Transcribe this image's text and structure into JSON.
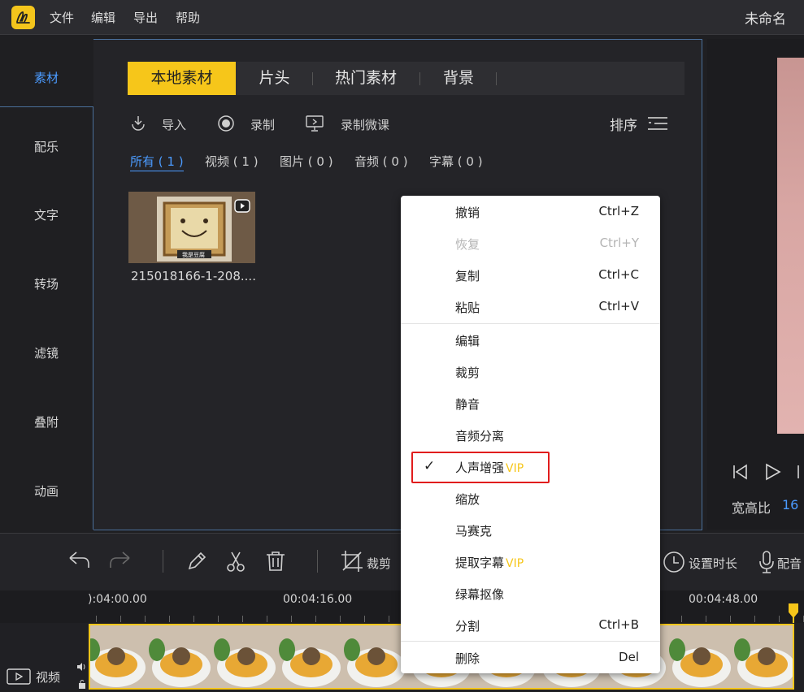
{
  "app": {
    "menu": [
      "文件",
      "编辑",
      "导出",
      "帮助"
    ],
    "project_name": "未命名"
  },
  "sidebar": {
    "items": [
      {
        "label": "素材",
        "active": true
      },
      {
        "label": "配乐"
      },
      {
        "label": "文字"
      },
      {
        "label": "转场"
      },
      {
        "label": "滤镜"
      },
      {
        "label": "叠附"
      },
      {
        "label": "动画"
      }
    ]
  },
  "media": {
    "tabs": [
      "本地素材",
      "片头",
      "热门素材",
      "背景"
    ],
    "tools": {
      "import": "导入",
      "record": "录制",
      "record_lesson": "录制微课",
      "sort": "排序"
    },
    "filters": [
      "所有 ( 1 )",
      "视频 ( 1 )",
      "图片 ( 0 )",
      "音频 ( 0 )",
      "字幕 ( 0 )"
    ],
    "thumb_overlay": "我是豆腐",
    "item_name": "215018166-1-208...."
  },
  "preview": {
    "ratio_label": "宽高比",
    "ratio_value": "16"
  },
  "timeline": {
    "crop_label": "裁剪",
    "set_duration_label": "设置时长",
    "dub_label": "配音",
    "times": [
      "):04:00.00",
      "00:04:16.00",
      "00:04:48.00"
    ],
    "track_label": "视频"
  },
  "context_menu": {
    "items": [
      {
        "label": "撤销",
        "shortcut": "Ctrl+Z"
      },
      {
        "label": "恢复",
        "shortcut": "Ctrl+Y",
        "disabled": true
      },
      {
        "label": "复制",
        "shortcut": "Ctrl+C"
      },
      {
        "label": "粘贴",
        "shortcut": "Ctrl+V"
      },
      {
        "label": "编辑"
      },
      {
        "label": "裁剪"
      },
      {
        "label": "静音"
      },
      {
        "label": "音频分离"
      },
      {
        "label": "人声增强",
        "vip": "VIP",
        "checked": true
      },
      {
        "label": "缩放"
      },
      {
        "label": "马赛克"
      },
      {
        "label": "提取字幕",
        "vip": "VIP"
      },
      {
        "label": "绿幕抠像"
      },
      {
        "label": "分割",
        "shortcut": "Ctrl+B"
      },
      {
        "label": "删除",
        "shortcut": "Del"
      }
    ]
  },
  "colors": {
    "accent": "#f6c61a",
    "link": "#4b9bff",
    "highlight": "#e11d1d"
  }
}
